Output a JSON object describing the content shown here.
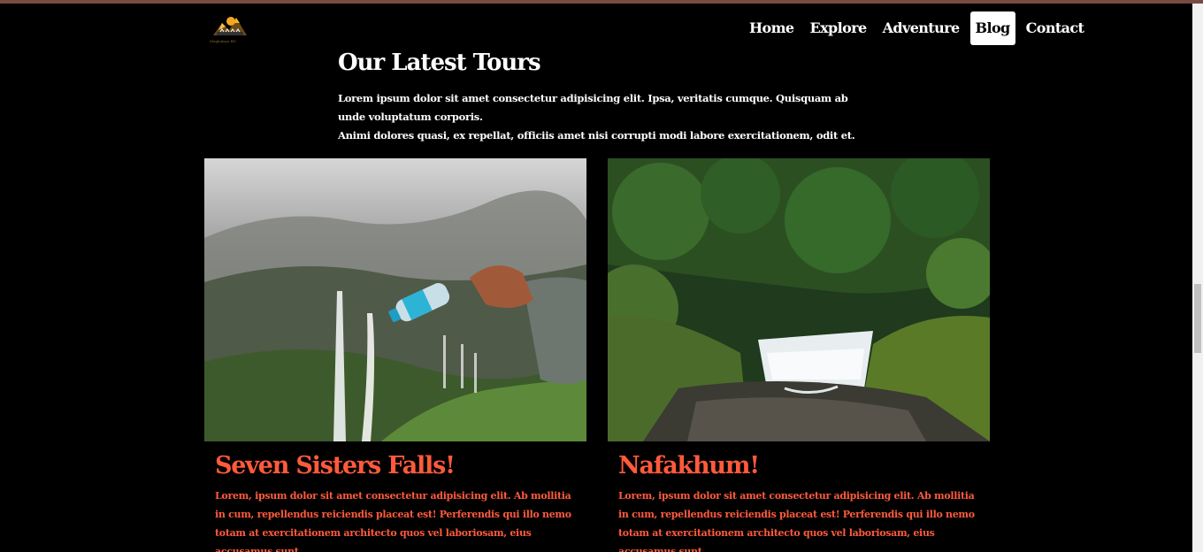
{
  "brand": {
    "logo_text": "Meghalaya BD"
  },
  "nav": {
    "items": [
      {
        "label": "Home"
      },
      {
        "label": "Explore"
      },
      {
        "label": "Adventure"
      },
      {
        "label": "Blog",
        "active": true
      },
      {
        "label": "Contact"
      }
    ]
  },
  "section": {
    "title": "Our Latest Tours",
    "description_line1": "Lorem ipsum dolor sit amet consectetur adipisicing elit. Ipsa, veritatis cumque. Quisquam ab unde voluptatum corporis.",
    "description_line2": "Animi dolores quasi, ex repellat, officiis amet nisi corrupti modi labore exercitationem, odit et."
  },
  "cards": [
    {
      "title": "Seven Sisters Falls!",
      "text": "Lorem, ipsum dolor sit amet consectetur adipisicing elit. Ab mollitia in cum, repellendus reiciendis placeat est! Perferendis qui illo nemo totam at exercitationem architecto quos vel laboriosam, eius accusamus sunt.",
      "image": "misty waterfall cliffs with hand pouring water bottle"
    },
    {
      "title": "Nafakhum!",
      "text": "Lorem, ipsum dolor sit amet consectetur adipisicing elit. Ab mollitia in cum, repellendus reiciendis placeat est! Perferendis qui illo nemo totam at exercitationem architecto quos vel laboriosam, eius accusamus sunt.",
      "image": "jungle waterfall with river and mossy rocks"
    }
  ],
  "colors": {
    "accent": "#ff5a3c",
    "background": "#000000",
    "topbar": "#7a4a42"
  }
}
